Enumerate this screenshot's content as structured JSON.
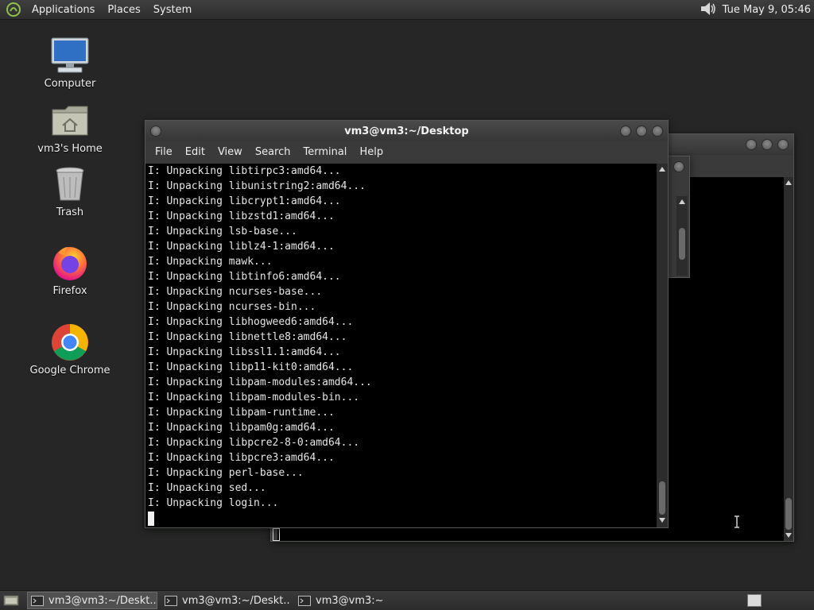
{
  "top_panel": {
    "menus": [
      "Applications",
      "Places",
      "System"
    ],
    "clock": "Tue May  9, 05:46",
    "volume_icon": "speaker-icon"
  },
  "desktop_icons": [
    {
      "label": "Computer",
      "icon": "computer-icon"
    },
    {
      "label": "vm3's Home",
      "icon": "home-folder-icon"
    },
    {
      "label": "Trash",
      "icon": "trash-icon"
    },
    {
      "label": "Firefox",
      "icon": "firefox-icon"
    },
    {
      "label": "Google Chrome",
      "icon": "chrome-icon"
    }
  ],
  "front_window": {
    "title": "vm3@vm3:~/Desktop",
    "menu": [
      "File",
      "Edit",
      "View",
      "Search",
      "Terminal",
      "Help"
    ],
    "lines": [
      "I: Unpacking libtirpc3:amd64...",
      "I: Unpacking libunistring2:amd64...",
      "I: Unpacking libcrypt1:amd64...",
      "I: Unpacking libzstd1:amd64...",
      "I: Unpacking lsb-base...",
      "I: Unpacking liblz4-1:amd64...",
      "I: Unpacking mawk...",
      "I: Unpacking libtinfo6:amd64...",
      "I: Unpacking ncurses-base...",
      "I: Unpacking ncurses-bin...",
      "I: Unpacking libhogweed6:amd64...",
      "I: Unpacking libnettle8:amd64...",
      "I: Unpacking libssl1.1:amd64...",
      "I: Unpacking libp11-kit0:amd64...",
      "I: Unpacking libpam-modules:amd64...",
      "I: Unpacking libpam-modules-bin...",
      "I: Unpacking libpam-runtime...",
      "I: Unpacking libpam0g:amd64...",
      "I: Unpacking libpcre2-8-0:amd64...",
      "I: Unpacking libpcre3:amd64...",
      "I: Unpacking perl-base...",
      "I: Unpacking sed...",
      "I: Unpacking login..."
    ]
  },
  "taskbar": {
    "tasks": [
      {
        "label": "vm3@vm3:~/Deskt...",
        "active": true
      },
      {
        "label": "vm3@vm3:~/Deskt...",
        "active": false
      },
      {
        "label": "vm3@vm3:~",
        "active": false
      }
    ]
  },
  "colors": {
    "desktop_bg": "#252625",
    "terminal_bg": "#000000",
    "terminal_fg": "#e6e6e6",
    "panel_bg": "#333333"
  }
}
